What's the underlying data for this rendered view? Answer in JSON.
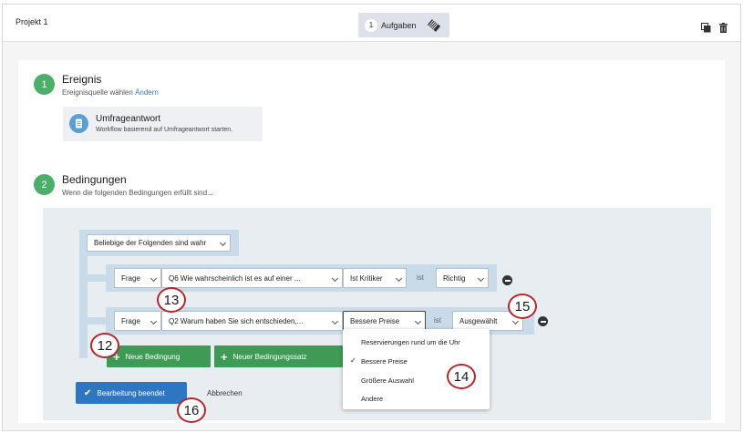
{
  "header": {
    "project_name": "Projekt 1",
    "tasks_count": "1",
    "tasks_label": "Aufgaben",
    "icons": [
      "copy-icon",
      "trash-icon",
      "task-tag-icon"
    ]
  },
  "event": {
    "step": "1",
    "title": "Ereignis",
    "subtitle": "Ereignisquelle wählen",
    "change_link": "Ändern",
    "source_title": "Umfrageantwort",
    "source_desc": "Workflow basierend auf Umfrageantwort starten."
  },
  "conditions": {
    "step": "2",
    "title": "Bedingungen",
    "subtitle": "Wenn die folgenden Bedingungen erfüllt sind...",
    "group_select": "Beliebige der Folgenden sind wahr",
    "rows": [
      {
        "type": "Frage",
        "question": "Q6 Wie wahrscheinlich ist es auf einer ...",
        "field": "Ist Kritiker",
        "operator": "ist",
        "value": "Richtig"
      },
      {
        "type": "Frage",
        "question": "Q2 Warum haben Sie sich entschieden,...",
        "field": "Bessere Preise",
        "operator": "ist",
        "value": "Ausgewählt"
      }
    ],
    "add_condition": "Neue Bedingung",
    "add_condition_set": "Neuer Bedingungssatz",
    "done_button": "Bearbeitung beendet",
    "cancel": "Abbrechen"
  },
  "dropdown": {
    "options": [
      "Reservierungen rund um die Uhr",
      "Bessere Preise",
      "Größere Auswahl",
      "Andere"
    ],
    "selected": "Bessere Preise"
  },
  "callouts": [
    "12",
    "13",
    "14",
    "15",
    "16"
  ],
  "colors": {
    "green": "#4cae68",
    "button_green": "#3e9a54",
    "blue": "#2e76c2",
    "callout_red": "#b3272d",
    "panel": "#e8edf2",
    "group": "#c9dbe9"
  }
}
